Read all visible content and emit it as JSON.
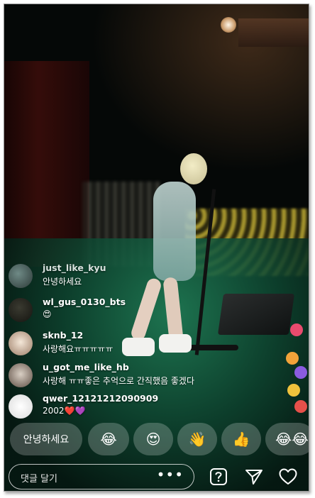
{
  "comments": [
    {
      "username": "just_like_kyu",
      "text": "안녕하세요"
    },
    {
      "username": "wl_gus_0130_bts",
      "text": "😍"
    },
    {
      "username": "sknb_12",
      "text": "사랑해요ㅠㅠㅠㅠㅠ"
    },
    {
      "username": "u_got_me_like_hb",
      "text": "사랑해 ㅠㅠ좋은 추억으로 간직했음 좋겠다"
    },
    {
      "username": "qwer_12121212090909",
      "text": "2002",
      "emoji": "❤️💜"
    }
  ],
  "quick_replies": [
    {
      "label": "안녕하세요"
    },
    {
      "label": "😂"
    },
    {
      "label": "😍"
    },
    {
      "label": "👋"
    },
    {
      "label": "👍"
    },
    {
      "label": "😂😂"
    }
  ],
  "composer": {
    "placeholder": "댓글 달기",
    "more": "•••"
  },
  "icons": {
    "question": "question-box-icon",
    "send": "paper-plane-icon",
    "like": "heart-icon"
  },
  "colors": {
    "accent_heart": "#ffffff",
    "overlay": "rgba(255,255,255,0.22)"
  }
}
